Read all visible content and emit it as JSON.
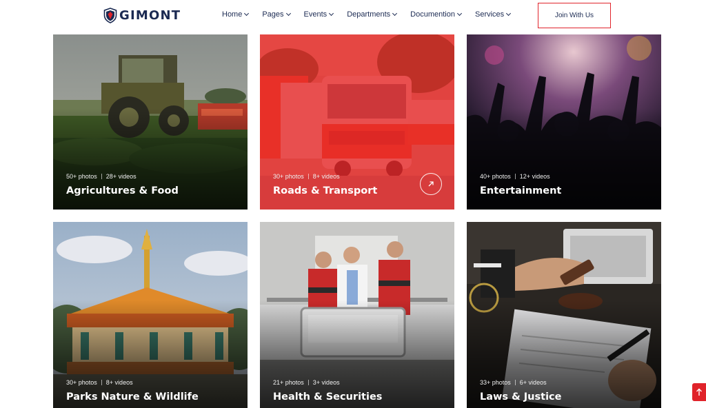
{
  "brand": {
    "name": "GIMONT",
    "color": "#1b2a52",
    "accent": "#e0232a"
  },
  "nav": {
    "items": [
      {
        "label": "Home"
      },
      {
        "label": "Pages"
      },
      {
        "label": "Events"
      },
      {
        "label": "Departments"
      },
      {
        "label": "Documention"
      },
      {
        "label": "Services"
      }
    ],
    "cta_label": "Join With Us"
  },
  "cards": [
    {
      "photos": "50+ photos",
      "videos": "28+ videos",
      "title": "Agricultures & Food"
    },
    {
      "photos": "30+ photos",
      "videos": "8+ videos",
      "title": "Roads & Transport",
      "active": true
    },
    {
      "photos": "40+ photos",
      "videos": "12+ videos",
      "title": "Entertainment"
    },
    {
      "photos": "30+ photos",
      "videos": "8+ videos",
      "title": "Parks Nature & Wildlife"
    },
    {
      "photos": "21+ photos",
      "videos": "3+ videos",
      "title": "Health & Securities"
    },
    {
      "photos": "33+ photos",
      "videos": "6+ videos",
      "title": "Laws & Justice"
    }
  ],
  "icons": {
    "logo": "shield-icon",
    "nav_dropdown": "chevron-down-icon",
    "card_link": "arrow-up-right-icon",
    "back_to_top": "arrow-up-icon"
  }
}
